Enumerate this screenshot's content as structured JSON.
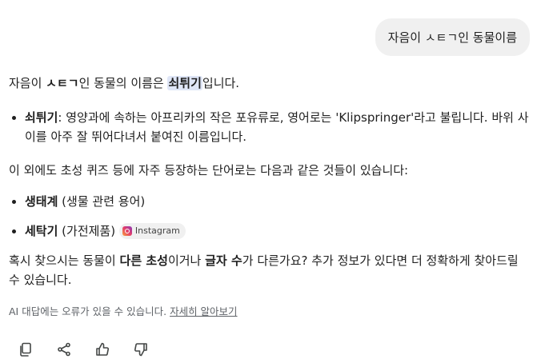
{
  "user_message": "자음이 ㅅㅌㄱ인 동물이름",
  "answer": {
    "intro": {
      "prefix": "자음이 ",
      "consonants": "ㅅㅌㄱ",
      "middle": "인 동물의 이름은 ",
      "highlight": "쇠튀기",
      "suffix": "입니다."
    },
    "main_item": {
      "term": "쇠튀기",
      "text": ": 영양과에 속하는 아프리카의 작은 포유류로, 영어로는 'Klipspringer'라고 불립니다. 바위 사이를 아주 잘 뛰어다녀서 붙여진 이름입니다."
    },
    "other_intro": "이 외에도 초성 퀴즈 등에 자주 등장하는 단어로는 다음과 같은 것들이 있습니다:",
    "other_items": [
      {
        "term": "생태계",
        "text": " (생물 관련 용어)"
      },
      {
        "term": "세탁기",
        "text": " (가전제품)",
        "source_chip": "Instagram"
      }
    ],
    "closing": {
      "part1": "혹시 찾으시는 동물이 ",
      "bold1": "다른 초성",
      "part2": "이거나 ",
      "bold2": "글자 수",
      "part3": "가 다른가요? 추가 정보가 있다면 더 정확하게 찾아드릴 수 있습니다."
    }
  },
  "disclaimer": {
    "text": "AI 대답에는 오류가 있을 수 있습니다. ",
    "link": "자세히 알아보기"
  },
  "actions": {
    "copy": "copy-icon",
    "share": "share-icon",
    "like": "thumbs-up-icon",
    "dislike": "thumbs-down-icon"
  }
}
